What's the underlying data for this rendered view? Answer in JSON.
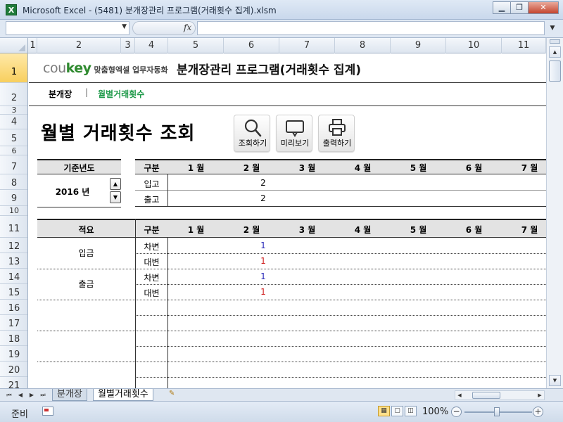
{
  "window": {
    "app_icon": "X",
    "title": "Microsoft Excel - (5481) 분개장관리 프로그램(거래횟수 집계).xlsm",
    "buttons": [
      "minimize-icon",
      "restore-icon",
      "close-icon"
    ]
  },
  "formula_bar": {
    "name_box": "",
    "fx_label": "fx",
    "formula": ""
  },
  "column_headers": [
    "1",
    "2",
    "3",
    "4",
    "5",
    "6",
    "7",
    "8",
    "9",
    "10",
    "11"
  ],
  "row_headers": [
    "1",
    "2",
    "3",
    "4",
    "5",
    "6",
    "7",
    "8",
    "9",
    "10",
    "11",
    "12",
    "13",
    "14",
    "15",
    "16",
    "17",
    "18",
    "19",
    "20",
    "21"
  ],
  "banner": {
    "logo_part1": "cou",
    "logo_part2": "key",
    "logo_tagline": "맞춤형엑셀 업무자동화",
    "program_title": "분개장관리 프로그램(거래횟수 집계)"
  },
  "nav": {
    "item1": "분개장",
    "separator": "|",
    "item2": "월별거래횟수"
  },
  "heading": "월별 거래횟수 조회",
  "toolbar": [
    {
      "label": "조회하기",
      "icon": "search-icon"
    },
    {
      "label": "미리보기",
      "icon": "preview-icon"
    },
    {
      "label": "출력하기",
      "icon": "print-icon"
    }
  ],
  "year_panel": {
    "label": "기준년도",
    "value": "2016 년"
  },
  "table1": {
    "col_label": "구분",
    "months": [
      "1 월",
      "2 월",
      "3 월",
      "4 월",
      "5 월",
      "6 월",
      "7 월"
    ],
    "rows": [
      {
        "label": "입고",
        "values": [
          "",
          "2",
          "",
          "",
          "",
          "",
          ""
        ]
      },
      {
        "label": "출고",
        "values": [
          "",
          "2",
          "",
          "",
          "",
          "",
          ""
        ]
      }
    ]
  },
  "table2": {
    "summary_label": "적요",
    "col_label": "구분",
    "months": [
      "1 월",
      "2 월",
      "3 월",
      "4 월",
      "5 월",
      "6 월",
      "7 월"
    ],
    "groups": [
      {
        "summary": "입금",
        "rows": [
          {
            "label": "차변",
            "values": [
              "",
              "1",
              "",
              "",
              "",
              "",
              ""
            ]
          },
          {
            "label": "대변",
            "values": [
              "",
              "1",
              "",
              "",
              "",
              "",
              ""
            ]
          }
        ]
      },
      {
        "summary": "출금",
        "rows": [
          {
            "label": "차변",
            "values": [
              "",
              "1",
              "",
              "",
              "",
              "",
              ""
            ]
          },
          {
            "label": "대변",
            "values": [
              "",
              "1",
              "",
              "",
              "",
              "",
              ""
            ]
          }
        ]
      }
    ]
  },
  "sheet_tabs": [
    "분개장",
    "월별거래횟수"
  ],
  "active_tab": "월별거래횟수",
  "status": {
    "ready": "준비",
    "zoom": "100%"
  },
  "colors": {
    "accent_green": "#1f9a4a",
    "debit_value": "#2a2ab8",
    "credit_value": "#d02020",
    "header_fill": "#e3e3e3",
    "active_row_header": "#f8cf5e"
  }
}
